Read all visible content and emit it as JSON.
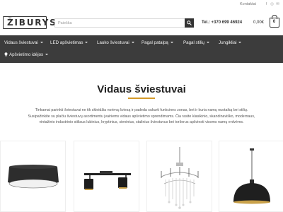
{
  "topbar": {
    "contact_label": "Kontaktai",
    "social": [
      {
        "icon": "facebook-icon",
        "glyph": "f"
      },
      {
        "icon": "instagram-icon",
        "glyph": "◎"
      },
      {
        "icon": "email-icon",
        "glyph": "✉"
      }
    ]
  },
  "header": {
    "logo_text": "ŽIBURYS",
    "search_placeholder": "Paieška",
    "phone": "Tel.: +370 699 46924",
    "cart_total": "0,00€",
    "cart_count": "0"
  },
  "nav": {
    "items": [
      {
        "label": "Vidaus šviestuvai"
      },
      {
        "label": "LED apšvietimas"
      },
      {
        "label": "Lauko šviestuvai"
      },
      {
        "label": "Pagal patalpą"
      },
      {
        "label": "Pagal stilių"
      },
      {
        "label": "Jungikliai"
      },
      {
        "label": "Apšvietimo idėjos"
      }
    ]
  },
  "main": {
    "title": "Vidaus šviestuvai",
    "description_lines": [
      "Tinkamai parinkti šviestuvai ne tik skleidžia norimą šviesą ir padeda sukurti funkcines zonas, bet ir kuria namų nuotaiką bei stilių.",
      "Susipažinkite su plačiu šviestuvų asortimentu įvairiems vidaus apšvietimo sprendimams. Čia rasite klasikinio, skandinaviško, modernaus,",
      "vintažinio industrinio stiliaus lubinius, kryptinius, sieninius, stalinius šviestuvus bei toršerus apšviesti visoms namų erdvėms."
    ],
    "products": [
      {
        "name": "ceiling-lamp"
      },
      {
        "name": "spotlight-bar"
      },
      {
        "name": "crystal-chandelier"
      },
      {
        "name": "pendant-dome-lamp"
      }
    ]
  },
  "colors": {
    "nav_bg": "#3c3c3c",
    "accent": "#d49a2a"
  }
}
